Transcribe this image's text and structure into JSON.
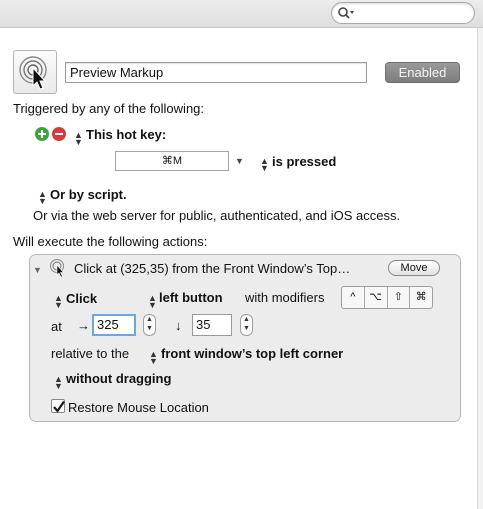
{
  "search": {
    "placeholder": "",
    "icon": "magnifier-icon"
  },
  "macro": {
    "icon": "click-cursor-icon",
    "name": "Preview Markup",
    "enabled_label": "Enabled"
  },
  "triggers": {
    "heading": "Triggered by any of the following:",
    "hotkey_label": "This hot key:",
    "hotkey_value": "⌘M",
    "hotkey_condition": "is pressed",
    "script_label": "Or by script.",
    "web_server_text": "Or via the web server for public, authenticated, and iOS access."
  },
  "actions": {
    "heading": "Will execute the following actions:",
    "title": "Click at (325,35) from the Front Window’s Top…",
    "move_label": "Move",
    "click_type": "Click",
    "button": "left button",
    "with_modifiers": "with modifiers",
    "modifiers": [
      "^",
      "⌥",
      "⇧",
      "⌘"
    ],
    "at_label": "at",
    "x_arrow": "→",
    "x_value": "325",
    "y_arrow": "↓",
    "y_value": "35",
    "relative_label": "relative to the",
    "relative_value": "front window’s top left corner",
    "drag_value": "without dragging",
    "restore_label": "Restore Mouse Location",
    "restore_checked": true
  },
  "colors": {
    "add_green": "#3ba43b",
    "remove_red": "#d83a3a",
    "focus_blue": "#6aa6e8",
    "enabled_gray": "#888888"
  }
}
